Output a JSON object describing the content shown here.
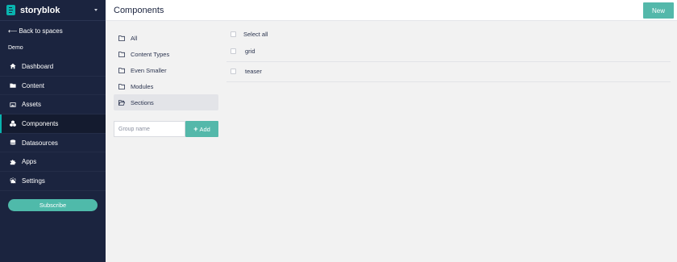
{
  "brand": {
    "name": "storyblok"
  },
  "sidebar": {
    "back_label": "Back to spaces",
    "space_name": "Demo",
    "items": [
      {
        "label": "Dashboard",
        "icon": "home-icon"
      },
      {
        "label": "Content",
        "icon": "folder-icon"
      },
      {
        "label": "Assets",
        "icon": "image-icon"
      },
      {
        "label": "Components",
        "icon": "cubes-icon",
        "active": true
      },
      {
        "label": "Datasources",
        "icon": "database-icon"
      },
      {
        "label": "Apps",
        "icon": "puzzle-icon"
      },
      {
        "label": "Settings",
        "icon": "gear-icon"
      }
    ],
    "subscribe_label": "Subscribe"
  },
  "header": {
    "title": "Components",
    "new_label": "New"
  },
  "groups": {
    "items": [
      {
        "label": "All"
      },
      {
        "label": "Content Types"
      },
      {
        "label": "Even Smaller"
      },
      {
        "label": "Modules"
      },
      {
        "label": "Sections",
        "selected": true
      }
    ],
    "input_placeholder": "Group name",
    "add_label": "Add"
  },
  "components": {
    "select_all_label": "Select all",
    "rows": [
      {
        "name": "grid"
      },
      {
        "name": "teaser"
      }
    ]
  },
  "colors": {
    "sidebar": "#1b243f",
    "accent": "#54b8aa",
    "brand_teal": "#09b3af"
  }
}
